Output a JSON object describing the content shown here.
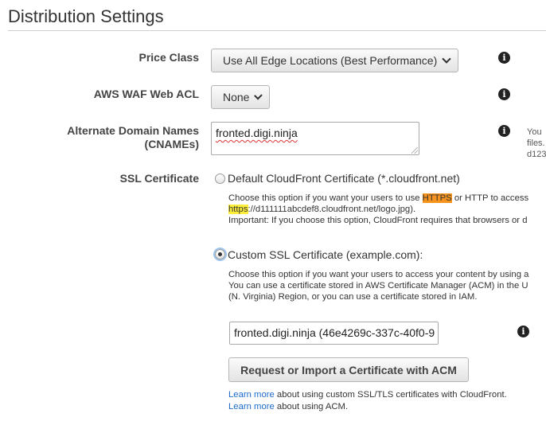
{
  "section": {
    "title": "Distribution Settings"
  },
  "price_class": {
    "label": "Price Class",
    "selected": "Use All Edge Locations (Best Performance)"
  },
  "waf": {
    "label": "AWS WAF Web ACL",
    "selected": "None"
  },
  "cnames": {
    "label_line1": "Alternate Domain Names",
    "label_line2": "(CNAMEs)",
    "value": "fronted.digi.ninja",
    "side_text": [
      "You",
      "files.",
      "d123"
    ]
  },
  "ssl": {
    "label": "SSL Certificate",
    "default_option": {
      "label": "Default CloudFront Certificate (*.cloudfront.net)",
      "desc_line1_pre": "Choose this option if you want your users to use ",
      "desc_line1_hl": "HTTPS",
      "desc_line1_post": " or HTTP to access",
      "desc_line2_hl": "https",
      "desc_line2_post": "://d111111abcdef8.cloudfront.net/logo.jpg).",
      "desc_line3": "Important: If you choose this option, CloudFront requires that browsers or d"
    },
    "custom_option": {
      "label": "Custom SSL Certificate (example.com):",
      "desc_line1": "Choose this option if you want your users to access your content by using a",
      "desc_line2": "You can use a certificate stored in AWS Certificate Manager (ACM) in the U",
      "desc_line3": "(N. Virginia) Region, or you can use a certificate stored in IAM.",
      "certificate_value": "fronted.digi.ninja (46e4269c-337c-40f0-9",
      "request_button": "Request or Import a Certificate with ACM"
    },
    "learn_more_1": {
      "link": "Learn more",
      "text": " about using custom SSL/TLS certificates with CloudFront."
    },
    "learn_more_2": {
      "link": "Learn more",
      "text": " about using ACM."
    }
  },
  "icons": {
    "info": "info-icon",
    "dropdown": "chevron-down-icon"
  },
  "colors": {
    "highlight_https": "#f7941d",
    "highlight_url": "#ffef3c",
    "link": "#1b6ac9"
  }
}
